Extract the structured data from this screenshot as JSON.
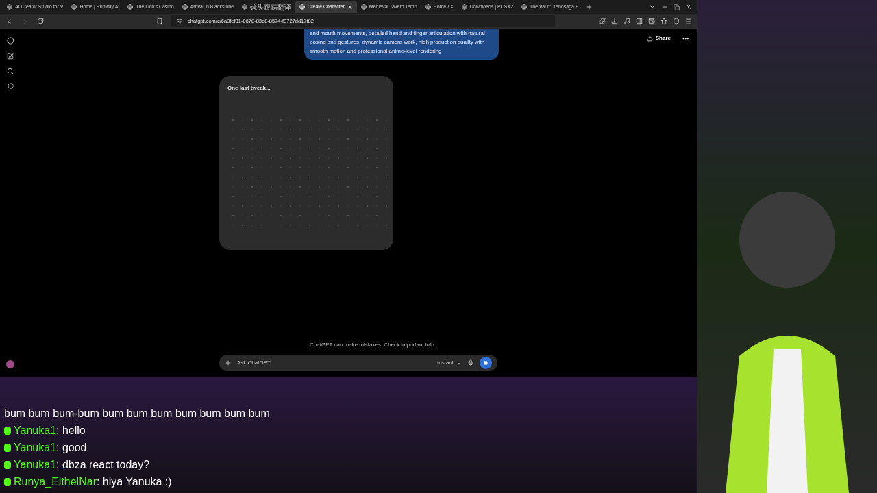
{
  "browser": {
    "tabs": [
      {
        "label": "AI Creator Studio for V",
        "selected": false
      },
      {
        "label": "Home | Runway AI",
        "selected": false
      },
      {
        "label": "The Lich's Casino",
        "selected": false
      },
      {
        "label": "Arrival in Blackstone",
        "selected": false
      },
      {
        "label": "镜头跟踪翻译",
        "selected": false
      },
      {
        "label": "Create Character",
        "selected": true
      },
      {
        "label": "Medieval Tavern Temp",
        "selected": false
      },
      {
        "label": "Home / X",
        "selected": false
      },
      {
        "label": "Downloads | PCSX2",
        "selected": false
      },
      {
        "label": "The Vault: Xenosaga E",
        "selected": false
      }
    ],
    "url": "chatgpt.com/c/6a8fef81-0678-83e8-8574-f8727dd17f82"
  },
  "chat": {
    "share_label": "Share",
    "user_message": "and mouth movements, detailed hand and finger articulation with natural posing and gestures, dynamic camera work, high production quality with smooth motion and professional anime-level rendering",
    "image_card": {
      "title": "One last tweak..."
    },
    "disclaimer": "ChatGPT can make mistakes. Check important info.",
    "composer": {
      "placeholder": "Ask ChatGPT",
      "model": "Instant"
    }
  },
  "stream_chat": [
    {
      "text": "bum bum bum-bum bum bum bum bum bum bum bum"
    },
    {
      "user": "Yanuka1",
      "text": ": hello"
    },
    {
      "user": "Yanuka1",
      "text": ": good"
    },
    {
      "user": "Yanuka1",
      "text": ": dbza react today?"
    },
    {
      "user": "Runya_EithelNar",
      "text": ": hiya Yanuka :)"
    }
  ]
}
